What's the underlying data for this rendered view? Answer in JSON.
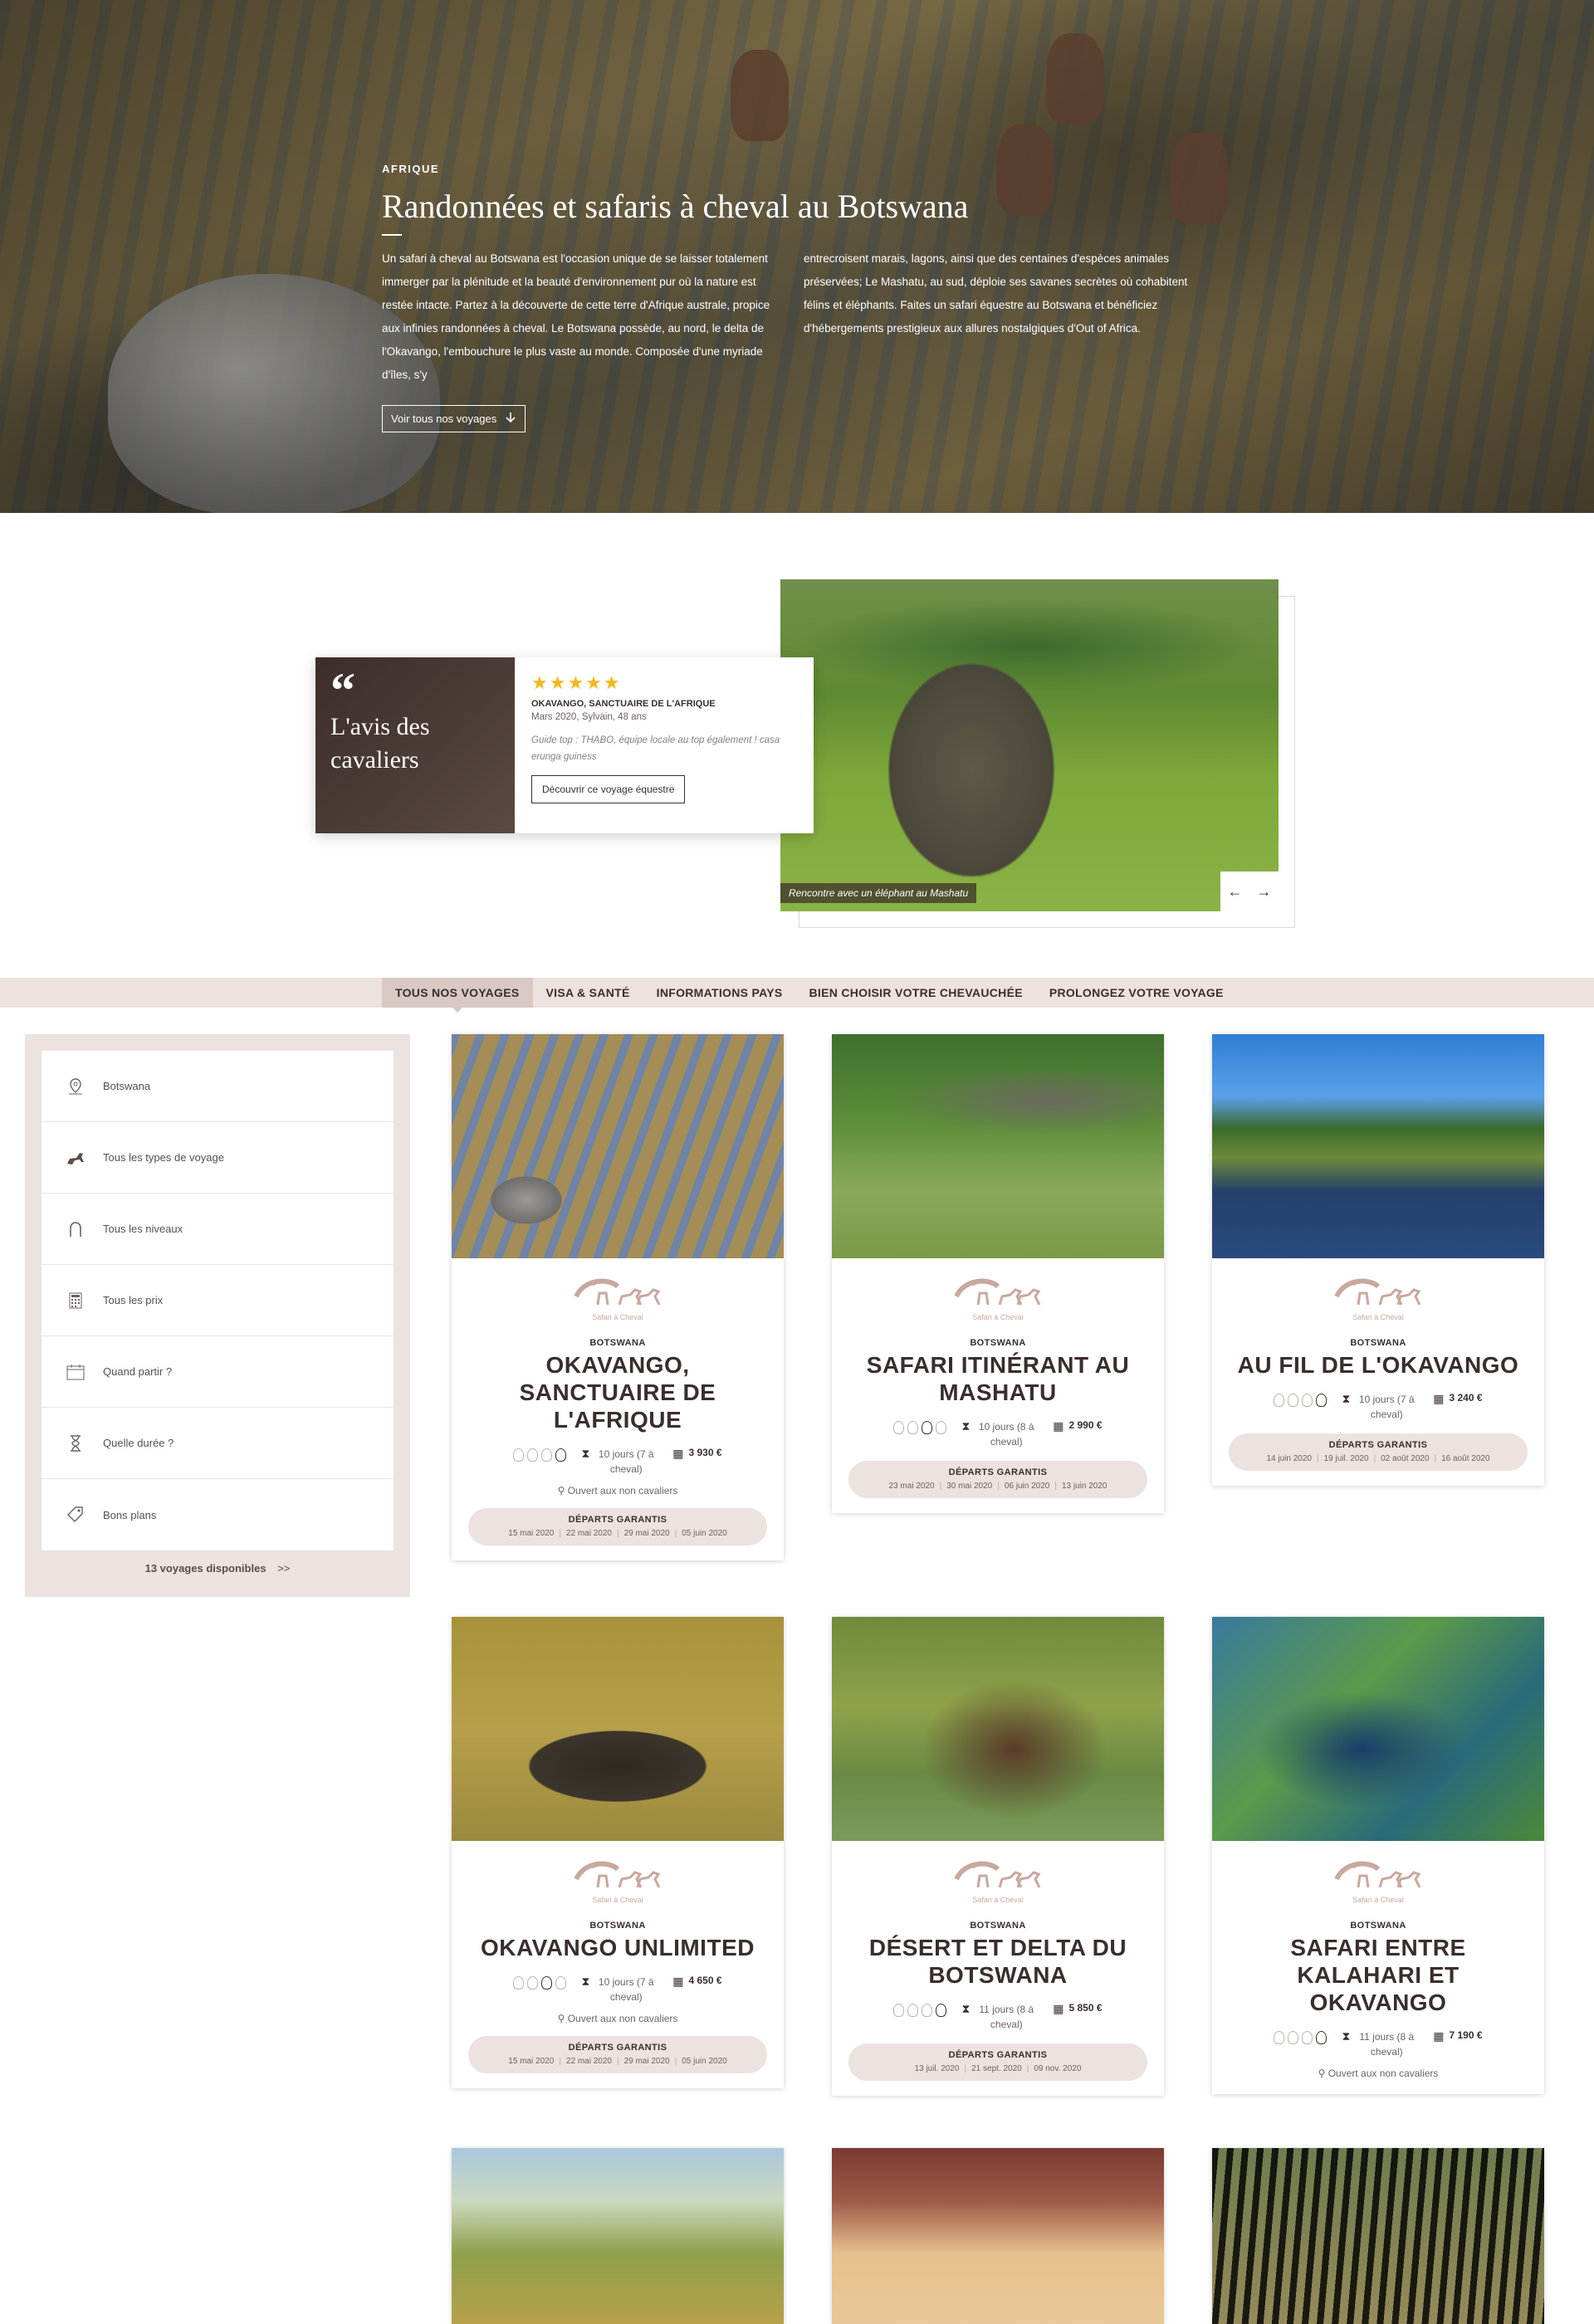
{
  "hero": {
    "kicker": "AFRIQUE",
    "title": "Randonnées et safaris à cheval au Botswana",
    "col1": "Un safari à cheval au Botswana est l'occasion unique de se laisser totalement immerger par la plénitude et la beauté d'environnement pur où la nature est restée intacte. Partez à la découverte de cette terre d'Afrique australe, propice aux infinies randonnées à cheval. Le Botswana possède, au nord, le delta de l'Okavango, l'embouchure le plus vaste au monde. Composée d'une myriade d'îles, s'y",
    "col2": "entrecroisent marais, lagons, ainsi que des centaines d'espèces animales préservées; Le Mashatu, au sud, déploie ses savanes secrètes où cohabitent félins et éléphants. Faites un safari équestre au Botswana et bénéficiez d'hébergements prestigieux aux allures nostalgiques d'Out of Africa.",
    "button": "Voir tous nos voyages"
  },
  "review": {
    "heading": "L'avis des cavaliers",
    "stars": "★★★★★",
    "trip": "OKAVANGO, SANCTUAIRE DE L'AFRIQUE",
    "meta": "Mars 2020, Sylvain, 48 ans",
    "text": "Guide top : THABO, équipe locale au top également ! casa erunga guiness",
    "button": "Découvrir ce voyage équestre",
    "photo_caption": "Rencontre avec un éléphant au Mashatu"
  },
  "tabs": [
    "TOUS NOS VOYAGES",
    "VISA & SANTÉ",
    "INFORMATIONS PAYS",
    "BIEN CHOISIR VOTRE CHEVAUCHÉE",
    "PROLONGEZ VOTRE VOYAGE"
  ],
  "filters": {
    "items": [
      {
        "label": "Botswana",
        "icon": "map-pin-icon"
      },
      {
        "label": "Tous les types de voyage",
        "icon": "horse-icon"
      },
      {
        "label": "Tous les niveaux",
        "icon": "horseshoe-icon"
      },
      {
        "label": "Tous les prix",
        "icon": "calculator-icon"
      },
      {
        "label": "Quand partir ?",
        "icon": "calendar-icon"
      },
      {
        "label": "Quelle durée ?",
        "icon": "hourglass-icon"
      },
      {
        "label": "Bons plans",
        "icon": "tag-icon"
      }
    ],
    "count": "13 voyages disponibles",
    "count_arrow": ">>"
  },
  "brand": "Safari à Cheval",
  "trips": [
    {
      "country": "BOTSWANA",
      "title": "OKAVANGO, SANCTUAIRE DE L'AFRIQUE",
      "level": 4,
      "duration": "10 jours (7 à cheval)",
      "price": "3 930 €",
      "open": "Ouvert aux non cavaliers",
      "dep_label": "DÉPARTS GARANTIS",
      "dates": [
        "15 mai 2020",
        "22 mai 2020",
        "29 mai 2020",
        "05 juin 2020"
      ]
    },
    {
      "country": "BOTSWANA",
      "title": "SAFARI ITINÉRANT AU MASHATU",
      "level": 3,
      "duration": "10 jours (8 à cheval)",
      "price": "2 990 €",
      "open": "",
      "dep_label": "DÉPARTS GARANTIS",
      "dates": [
        "23 mai 2020",
        "30 mai 2020",
        "06 juin 2020",
        "13 juin 2020"
      ]
    },
    {
      "country": "BOTSWANA",
      "title": "AU FIL DE L'OKAVANGO",
      "level": 4,
      "duration": "10 jours (7 à cheval)",
      "price": "3 240 €",
      "open": "",
      "dep_label": "DÉPARTS GARANTIS",
      "dates": [
        "14 juin 2020",
        "19 juil. 2020",
        "02 août 2020",
        "16 août 2020"
      ]
    },
    {
      "country": "BOTSWANA",
      "title": "OKAVANGO UNLIMITED",
      "level": 3,
      "duration": "10 jours (7 à cheval)",
      "price": "4 650 €",
      "open": "Ouvert aux non cavaliers",
      "dep_label": "DÉPARTS GARANTIS",
      "dates": [
        "15 mai 2020",
        "22 mai 2020",
        "29 mai 2020",
        "05 juin 2020"
      ]
    },
    {
      "country": "BOTSWANA",
      "title": "DÉSERT ET DELTA DU BOTSWANA",
      "level": 4,
      "duration": "11 jours (8 à cheval)",
      "price": "5 850 €",
      "open": "",
      "dep_label": "DÉPARTS GARANTIS",
      "dates": [
        "13 juil. 2020",
        "21 sept. 2020",
        "09 nov. 2020"
      ]
    },
    {
      "country": "BOTSWANA",
      "title": "SAFARI ENTRE KALAHARI ET OKAVANGO",
      "level": 4,
      "duration": "11 jours (8 à cheval)",
      "price": "7 190 €",
      "open": "Ouvert aux non cavaliers",
      "dep_label": "",
      "dates": []
    }
  ],
  "colors": {
    "accent": "#3a2e2c",
    "panel": "#ece2df",
    "star": "#f3b71c"
  }
}
